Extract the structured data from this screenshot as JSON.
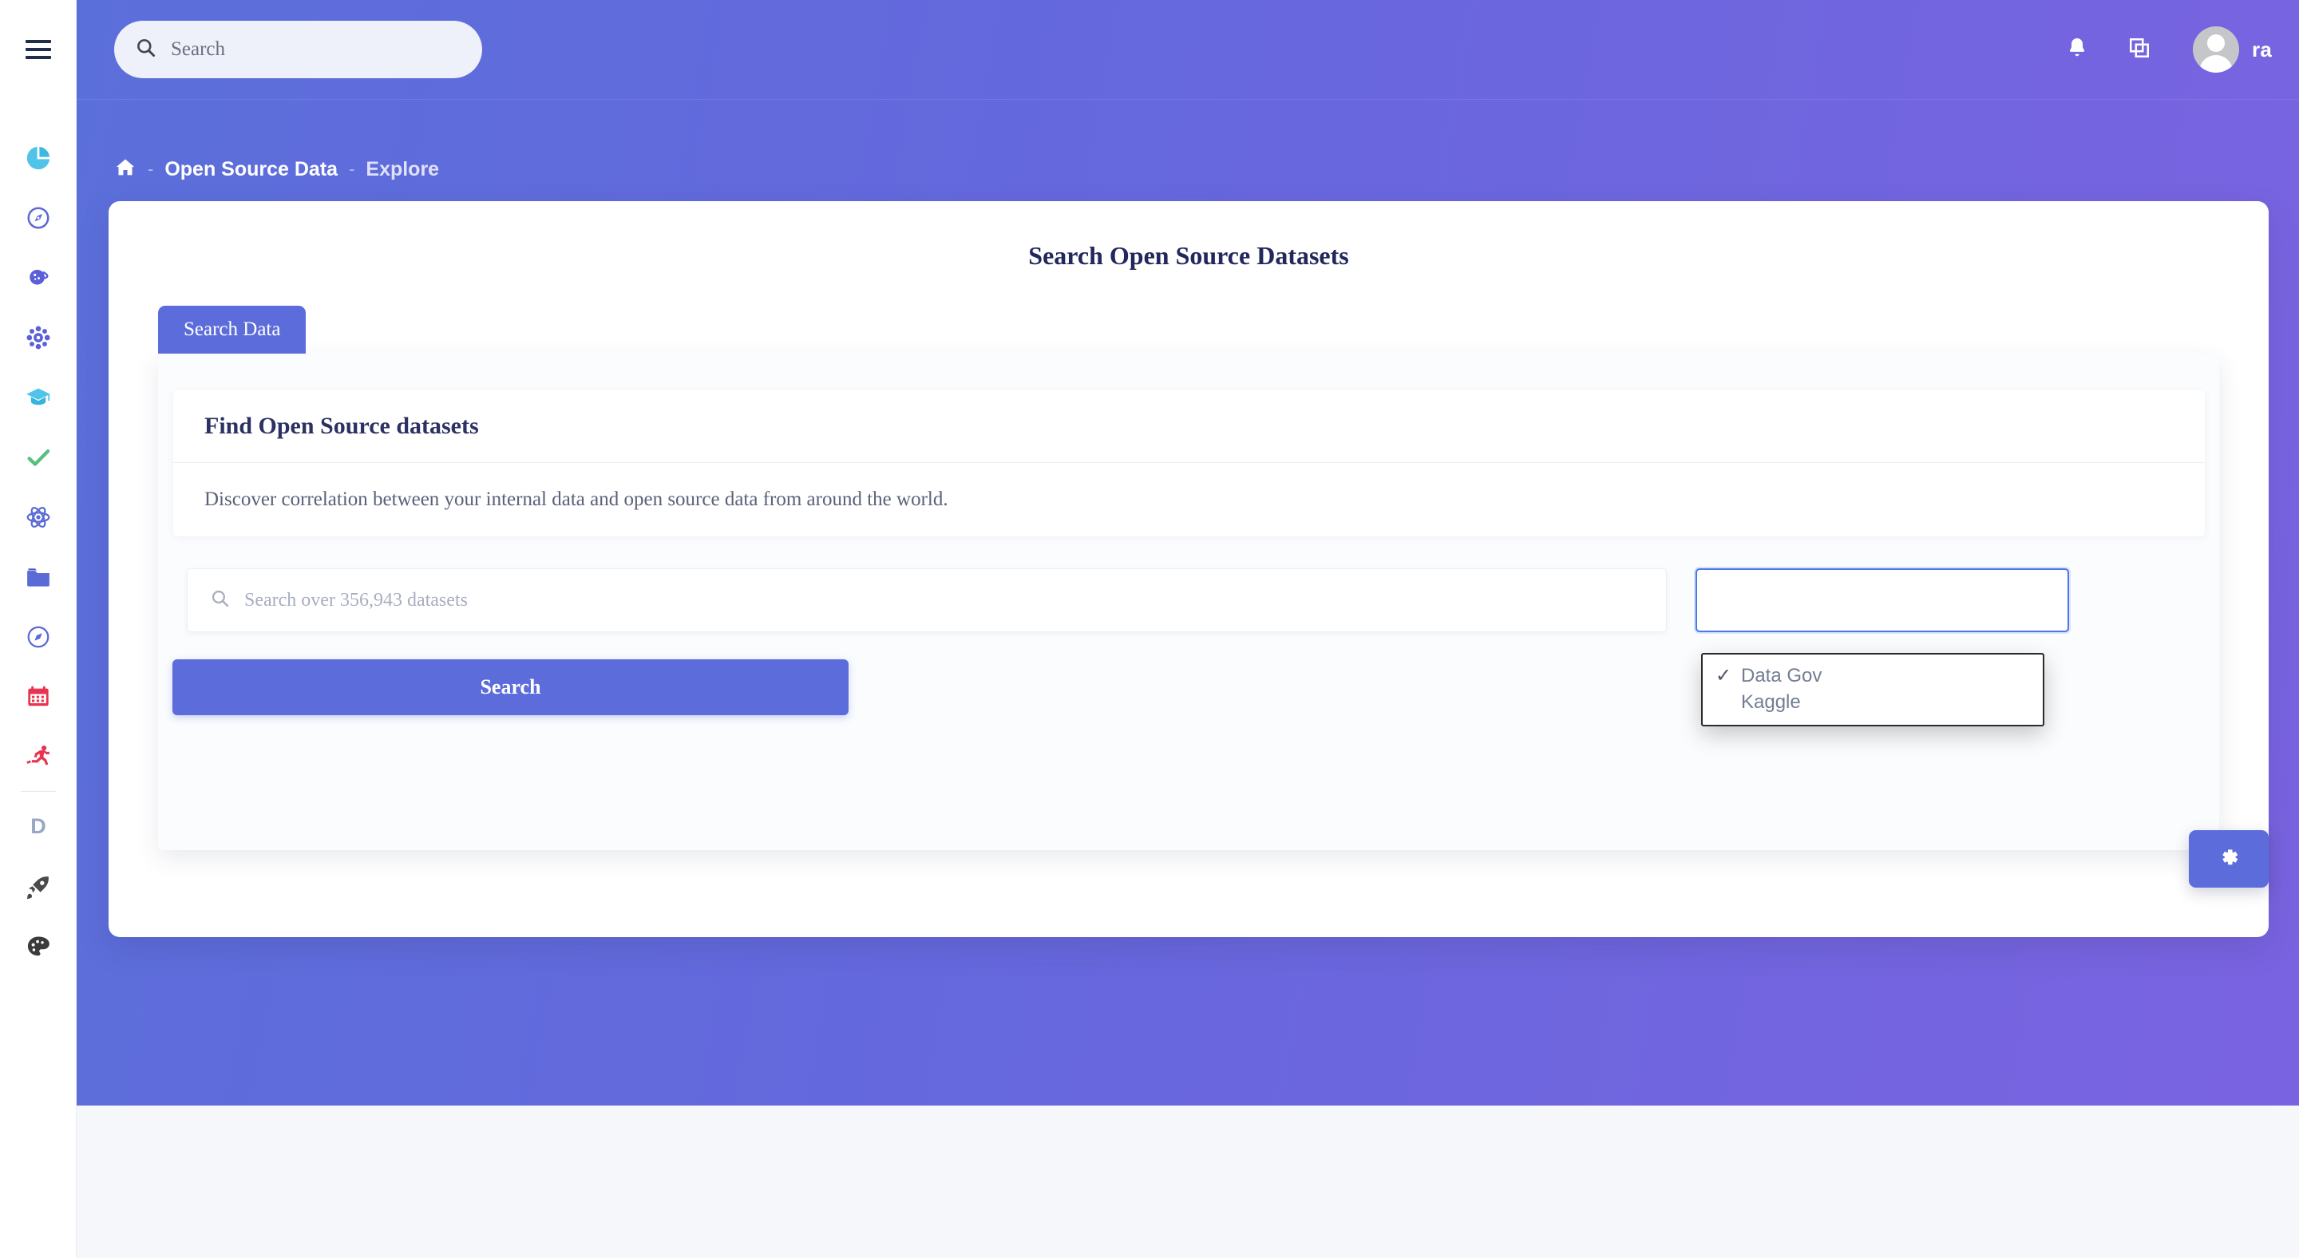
{
  "theme": {
    "accent": "#5c6ddb",
    "header_gradient_from": "#5b6fda",
    "header_gradient_to": "#7a63e0",
    "page_bg": "#f6f7fb",
    "title_color": "#22275c",
    "muted_text": "#5a6178"
  },
  "topbar": {
    "menu_icon": "hamburger-icon",
    "search": {
      "placeholder": "Search",
      "icon": "search-icon"
    },
    "notifications_icon": "bell-icon",
    "apps_icon": "copy-windows-icon",
    "avatar_icon": "user-avatar",
    "username": "ra"
  },
  "breadcrumb": {
    "home_icon": "home-icon",
    "separator": "-",
    "items": [
      {
        "label": "Open Source Data",
        "active": true
      },
      {
        "label": "Explore",
        "active": false
      }
    ]
  },
  "sidebar": {
    "items": [
      {
        "name": "pie-chart-icon",
        "label": "Dashboards"
      },
      {
        "name": "compass-icon",
        "label": "Explore"
      },
      {
        "name": "planet-icon",
        "label": "Data World"
      },
      {
        "name": "atom-gear-icon",
        "label": "Models"
      },
      {
        "name": "graduation-cap-icon",
        "label": "Learn"
      },
      {
        "name": "check-icon",
        "label": "Approvals"
      },
      {
        "name": "atom-icon",
        "label": "Science"
      },
      {
        "name": "folder-icon",
        "label": "Projects"
      },
      {
        "name": "compass-outline-icon",
        "label": "Discover"
      },
      {
        "name": "calendar-icon",
        "label": "Calendar"
      },
      {
        "name": "runner-icon",
        "label": "Activity"
      },
      {
        "name": "divider",
        "label": ""
      },
      {
        "name": "letter-d-icon",
        "label": "D"
      },
      {
        "name": "rocket-icon",
        "label": "Launch"
      },
      {
        "name": "palette-icon",
        "label": "Theme"
      }
    ],
    "letter_d": "D"
  },
  "main": {
    "page_title": "Search Open Source Datasets",
    "tabs": [
      {
        "label": "Search Data",
        "active": true
      }
    ],
    "description_card": {
      "heading": "Find Open Source datasets",
      "body": "Discover correlation between your internal data and open source data from around the world."
    },
    "dataset_search": {
      "placeholder": "Search over 356,943 datasets",
      "value": "",
      "icon": "search-icon"
    },
    "source_select": {
      "value": "Data Gov",
      "expanded": true,
      "options": [
        {
          "label": "Data Gov",
          "selected": true,
          "check": "✓"
        },
        {
          "label": "Kaggle",
          "selected": false,
          "check": ""
        }
      ]
    },
    "search_button": {
      "label": "Search"
    },
    "settings_tab": {
      "icon": "gear-icon",
      "label": "Settings"
    }
  }
}
